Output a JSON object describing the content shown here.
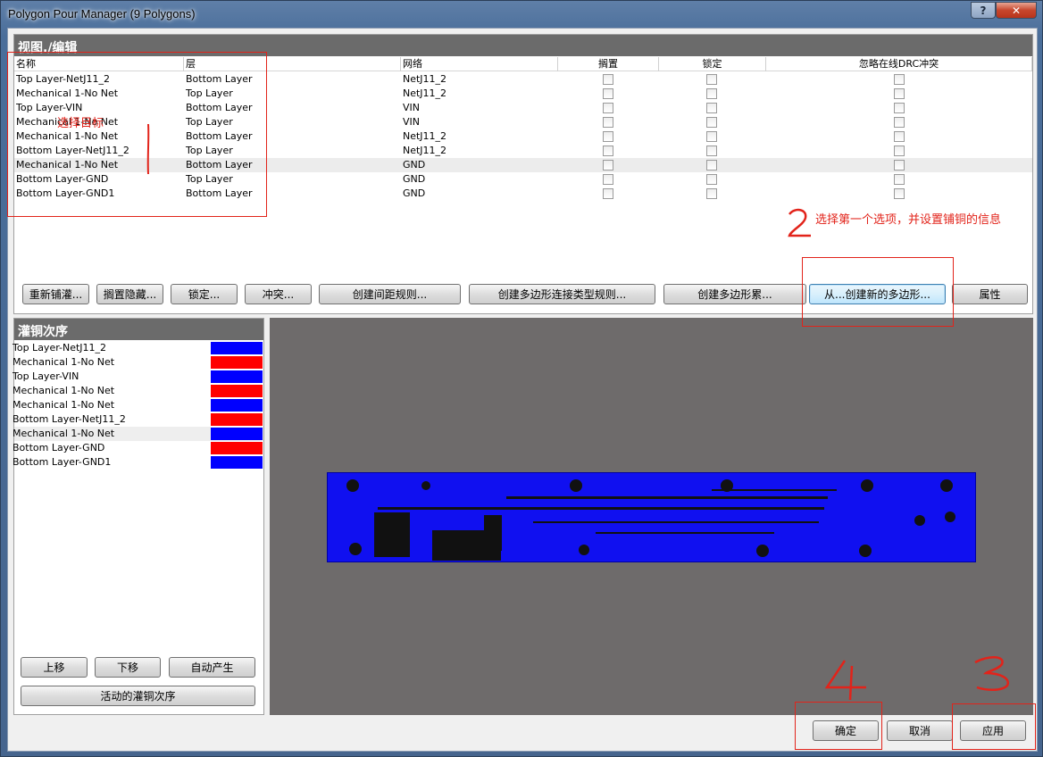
{
  "window": {
    "title": "Polygon Pour Manager (9 Polygons)",
    "help_glyph": "?",
    "close_glyph": "✕"
  },
  "top_panel": {
    "title": "视图./编辑",
    "columns": [
      "名称",
      "层",
      "网络",
      "搁置",
      "锁定",
      "忽略在线DRC冲突"
    ],
    "rows": [
      {
        "name": "Top Layer-NetJ11_2",
        "layer": "Bottom Layer",
        "net": "NetJ11_2"
      },
      {
        "name": "Mechanical 1-No Net",
        "layer": "Top Layer",
        "net": "NetJ11_2"
      },
      {
        "name": "Top Layer-VIN",
        "layer": "Bottom Layer",
        "net": "VIN"
      },
      {
        "name": "Mechanical 1-No Net",
        "layer": "Top Layer",
        "net": "VIN"
      },
      {
        "name": "Mechanical 1-No Net",
        "layer": "Bottom Layer",
        "net": "NetJ11_2"
      },
      {
        "name": "Bottom Layer-NetJ11_2",
        "layer": "Top Layer",
        "net": "NetJ11_2"
      },
      {
        "name": "Mechanical 1-No Net",
        "layer": "Bottom Layer",
        "net": "GND"
      },
      {
        "name": "Bottom Layer-GND",
        "layer": "Top Layer",
        "net": "GND"
      },
      {
        "name": "Bottom Layer-GND1",
        "layer": "Bottom Layer",
        "net": "GND"
      }
    ]
  },
  "toolbar": {
    "repour": "重新铺灌...",
    "shelve_hide": "搁置隐藏...",
    "lock": "锁定...",
    "conflict": "冲突...",
    "clearance_rule": "创建间距规则...",
    "connect_rule": "创建多边形连接类型规则...",
    "create_class": "创建多边形累...",
    "create_from": "从...创建新的多边形...",
    "properties": "属性"
  },
  "order_panel": {
    "title": "灌铜次序",
    "items": [
      {
        "name": "Top Layer-NetJ11_2",
        "color": "#0000ff"
      },
      {
        "name": "Mechanical 1-No Net",
        "color": "#ff0000"
      },
      {
        "name": "Top Layer-VIN",
        "color": "#0000ff"
      },
      {
        "name": "Mechanical 1-No Net",
        "color": "#ff0000"
      },
      {
        "name": "Mechanical 1-No Net",
        "color": "#0000ff"
      },
      {
        "name": "Bottom Layer-NetJ11_2",
        "color": "#ff0000"
      },
      {
        "name": "Mechanical 1-No Net",
        "color": "#0000ff"
      },
      {
        "name": "Bottom Layer-GND",
        "color": "#ff0000"
      },
      {
        "name": "Bottom Layer-GND1",
        "color": "#0000ff"
      }
    ],
    "move_up": "上移",
    "move_down": "下移",
    "auto_generate": "自动产生",
    "active_order": "活动的灌铜次序"
  },
  "footer": {
    "ok": "确定",
    "cancel": "取消",
    "apply": "应用"
  },
  "annotations": {
    "select_target": "选择目标",
    "step2_text": "选择第一个选项，并设置铺铜的信息",
    "step1": "1",
    "step2": "2",
    "step3": "3",
    "step4": "4",
    "color": "#e2231a"
  }
}
